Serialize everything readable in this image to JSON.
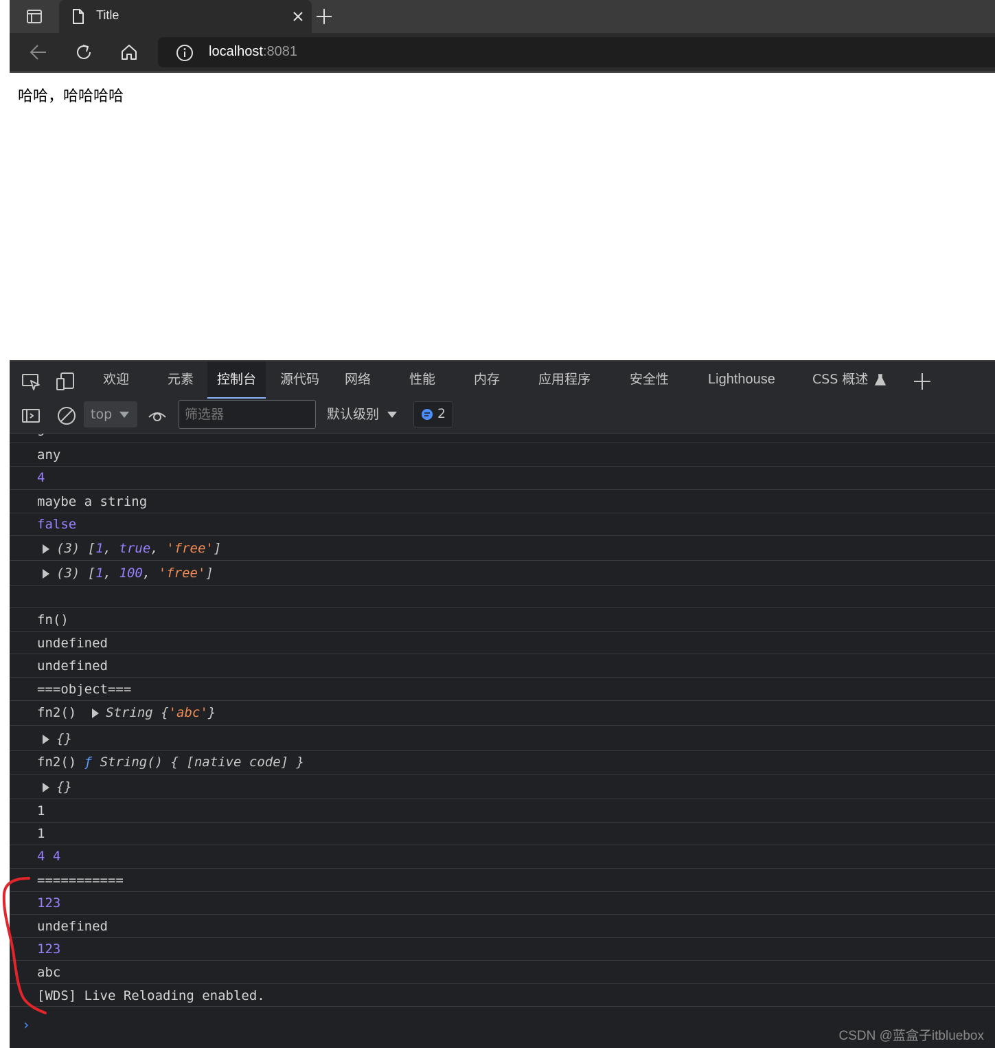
{
  "browser": {
    "tab_title": "Title",
    "url_host": "localhost",
    "url_port": ":8081"
  },
  "page": {
    "text": "哈哈，哈哈哈哈"
  },
  "devtools": {
    "tabs": [
      {
        "label": "欢迎"
      },
      {
        "label": "元素"
      },
      {
        "label": "控制台"
      },
      {
        "label": "源代码"
      },
      {
        "label": "网络"
      },
      {
        "label": "性能"
      },
      {
        "label": "内存"
      },
      {
        "label": "应用程序"
      },
      {
        "label": "安全性"
      },
      {
        "label": "Lighthouse"
      },
      {
        "label": "CSS 概述"
      }
    ],
    "active_tab": "控制台",
    "toolbar": {
      "context": "top",
      "filter_placeholder": "筛选器",
      "level": "默认级别",
      "issues_count": "2"
    }
  },
  "console": {
    "clipped_top": "green",
    "lines": {
      "any": "any",
      "n4": "4",
      "maybe": "maybe a string",
      "false": "false",
      "arr1_prefix": "(3) [",
      "arr1_a": "1",
      "arr1_b": "true",
      "arr1_c": "'free'",
      "arr1_suffix": "]",
      "arr2_prefix": "(3) [",
      "arr2_a": "1",
      "arr2_b": "100",
      "arr2_c": "'free'",
      "arr2_suffix": "]",
      "fn": "fn()",
      "undef1": "undefined",
      "undef2": "undefined",
      "obj_header": "===object===",
      "fn2_a": "fn2()",
      "fn2_a_obj": "String {",
      "fn2_a_val": "'abc'",
      "fn2_a_end": "}",
      "empty_obj1": "{}",
      "fn2_b": "fn2()",
      "fn2_b_f": "ƒ",
      "fn2_b_sig": "String() { [native code] }",
      "empty_obj2": "{}",
      "one1": "1",
      "one2": "1",
      "four_four": "4 4",
      "separator": "===========",
      "v123a": "123",
      "undef3": "undefined",
      "v123b": "123",
      "abc": "abc",
      "wds": "[WDS] Live Reloading enabled."
    },
    "prompt": "›"
  },
  "watermark": "CSDN @蓝盒子itbluebox",
  "colors": {
    "chrome_bg": "#3b3b3b",
    "devtools_bg": "#202124",
    "number": "#9980ff",
    "string": "#f28b54",
    "annotation": "#e0252b"
  }
}
